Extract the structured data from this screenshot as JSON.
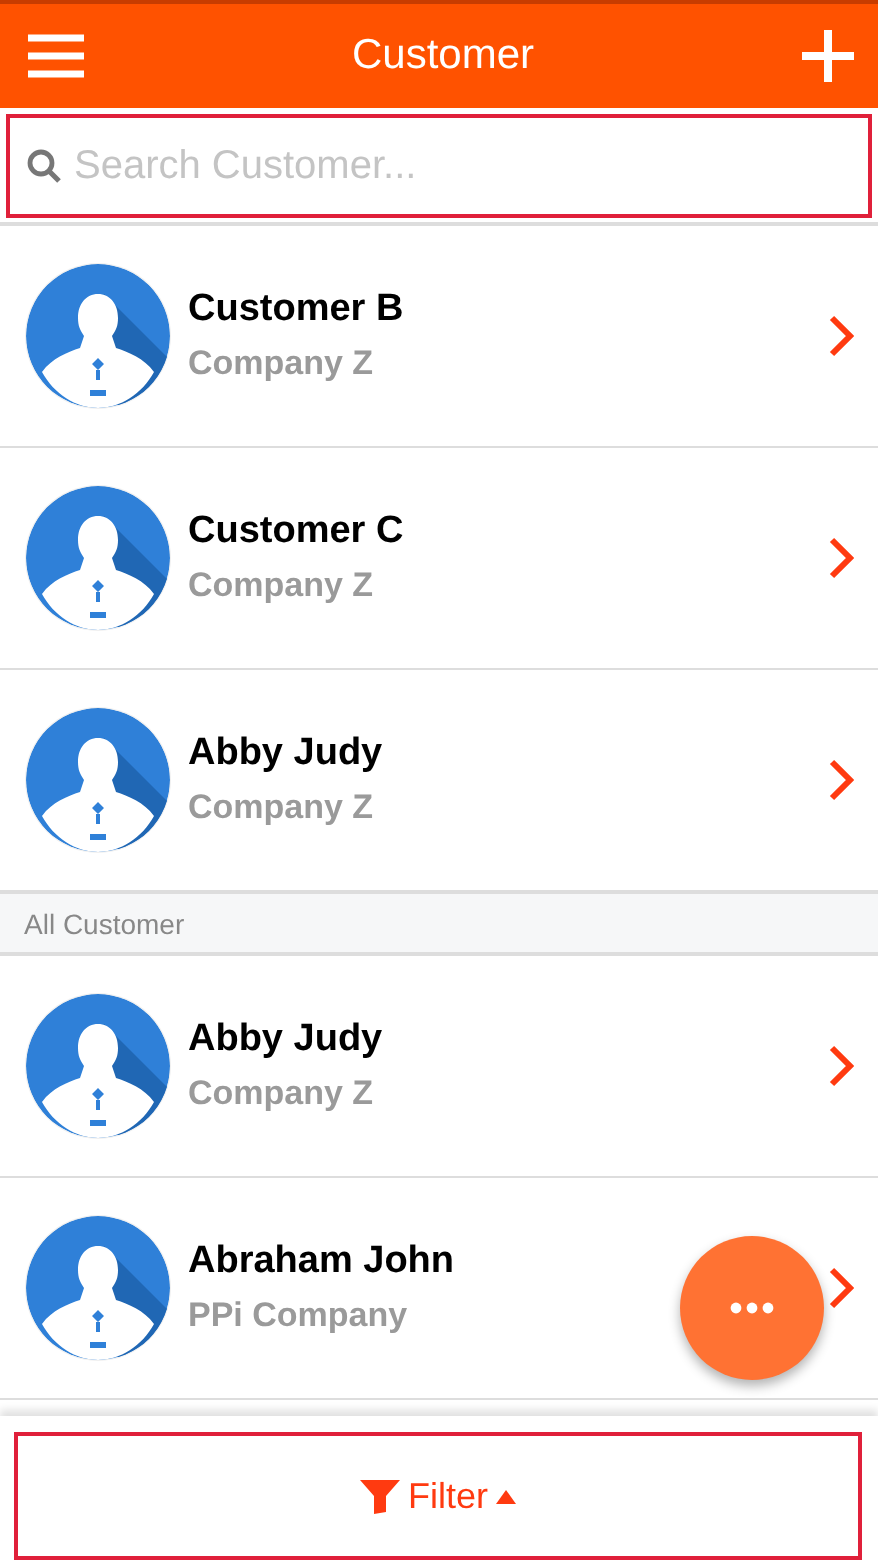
{
  "header": {
    "title": "Customer"
  },
  "search": {
    "placeholder": "Search Customer..."
  },
  "sections": [
    {
      "items": [
        {
          "name": "Customer B",
          "company": "Company Z"
        },
        {
          "name": "Customer C",
          "company": "Company Z"
        },
        {
          "name": "Abby Judy",
          "company": "Company Z"
        }
      ]
    },
    {
      "title": "All Customer",
      "items": [
        {
          "name": "Abby Judy",
          "company": "Company Z"
        },
        {
          "name": "Abraham John",
          "company": "PPi Company"
        }
      ]
    }
  ],
  "filter_button": {
    "label": "Filter"
  }
}
